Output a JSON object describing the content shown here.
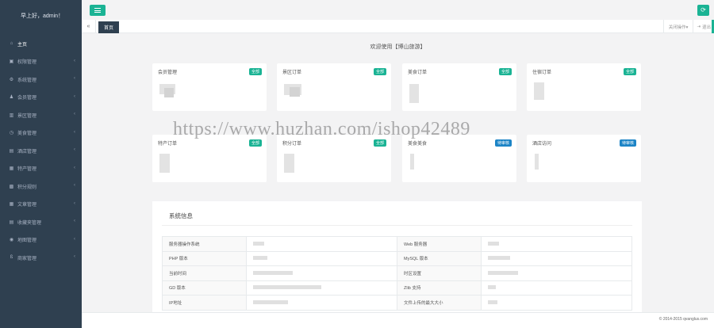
{
  "sidebar": {
    "greeting": "早上好，admin！",
    "items": [
      {
        "label": "主页",
        "icon": "home-icon",
        "glyph": "⌂"
      },
      {
        "label": "权限管理",
        "icon": "lock-icon",
        "glyph": "▣"
      },
      {
        "label": "系统管理",
        "icon": "gear-icon",
        "glyph": "⚙"
      },
      {
        "label": "会员管理",
        "icon": "user-icon",
        "glyph": "♟"
      },
      {
        "label": "景区管理",
        "icon": "building-icon",
        "glyph": "▥"
      },
      {
        "label": "美食管理",
        "icon": "clock-icon",
        "glyph": "◷"
      },
      {
        "label": "酒店管理",
        "icon": "hotel-icon",
        "glyph": "▤"
      },
      {
        "label": "特产管理",
        "icon": "gift-icon",
        "glyph": "▦"
      },
      {
        "label": "积分规则",
        "icon": "rules-icon",
        "glyph": "▩"
      },
      {
        "label": "文章管理",
        "icon": "article-icon",
        "glyph": "▦"
      },
      {
        "label": "收藏夹管理",
        "icon": "favorites-icon",
        "glyph": "▤"
      },
      {
        "label": "地图管理",
        "icon": "map-pin-icon",
        "glyph": "◉"
      },
      {
        "label": "商家管理",
        "icon": "merchant-icon",
        "glyph": "ß"
      }
    ],
    "arrow_glyph": "‹"
  },
  "toolbar": {
    "refresh_glyph": "⟳"
  },
  "tabs": {
    "back_glyph": "«",
    "home_label": "首页",
    "close_ops_label": "关闭操作▾",
    "logout_label": "退出",
    "logout_glyph": "⇥"
  },
  "content": {
    "welcome": "欢迎使用【博山旅游】",
    "cards_row1": [
      {
        "title": "会员管理",
        "badge": "全部",
        "badge_color": "green"
      },
      {
        "title": "景区订单",
        "badge": "全部",
        "badge_color": "green"
      },
      {
        "title": "美食订单",
        "badge": "全部",
        "badge_color": "green"
      },
      {
        "title": "住宿订单",
        "badge": "全部",
        "badge_color": "green"
      }
    ],
    "cards_row2": [
      {
        "title": "特产订单",
        "badge": "全部",
        "badge_color": "green"
      },
      {
        "title": "积分订单",
        "badge": "全部",
        "badge_color": "green"
      },
      {
        "title": "美食美食",
        "badge": "待审核",
        "badge_color": "blue"
      },
      {
        "title": "酒店访问",
        "badge": "待审核",
        "badge_color": "blue"
      }
    ],
    "sysinfo": {
      "title": "系统信息",
      "rows": [
        {
          "l1": "服务器操作系统",
          "l2": "Web 服务器"
        },
        {
          "l1": "PHP 版本",
          "l2": "MySQL 版本"
        },
        {
          "l1": "当前时间",
          "l2": "时区设置"
        },
        {
          "l1": "GD 版本",
          "l2": "Zlib 支持"
        },
        {
          "l1": "IP地址",
          "l2": "文件上传的最大大小"
        }
      ]
    }
  },
  "footer": {
    "copyright": "© 2014-2015 qvanglus.com"
  },
  "colors": {
    "accent": "#1ab394",
    "sidebar": "#2f4050",
    "blue_badge": "#1c84c6"
  },
  "watermark": "https://www.huzhan.com/ishop42489"
}
